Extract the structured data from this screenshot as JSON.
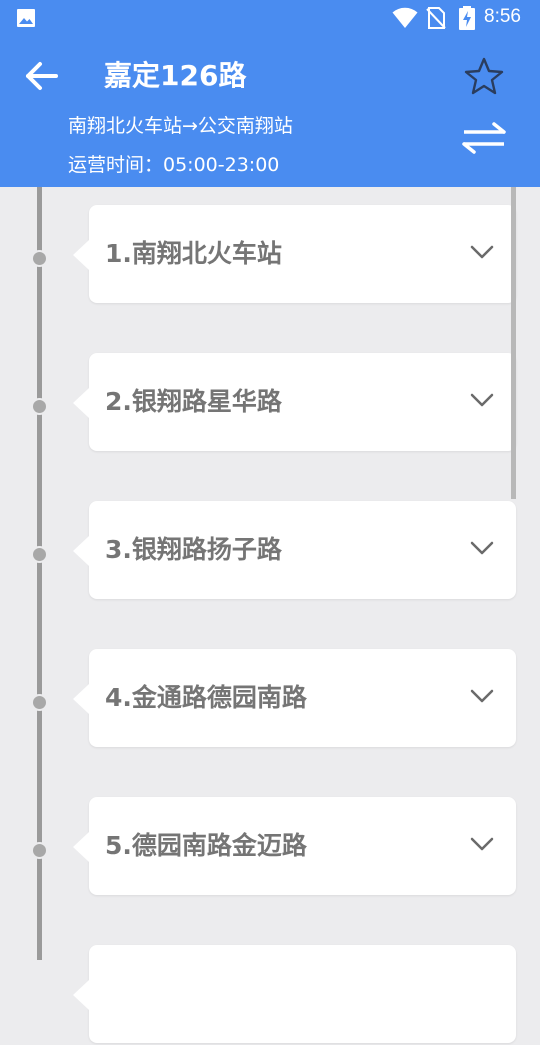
{
  "status_bar": {
    "time": "8:56",
    "icons": [
      "image-icon",
      "wifi-icon",
      "no-sim-icon",
      "battery-charging-icon"
    ]
  },
  "header": {
    "title": "嘉定126路",
    "route": "南翔北火车站→公交南翔站",
    "hours": "运营时间：05:00-23:00",
    "back_icon": "arrow-left-icon",
    "favorite_icon": "star-outline-icon",
    "swap_icon": "swap-direction-icon"
  },
  "colors": {
    "primary": "#4a8cf0",
    "background": "#ececee",
    "card": "#ffffff",
    "stop_text": "#757575",
    "timeline": "#9a9a9a"
  },
  "stops": [
    {
      "label": "1.南翔北火车站"
    },
    {
      "label": "2.银翔路星华路"
    },
    {
      "label": "3.银翔路扬子路"
    },
    {
      "label": "4.金通路德园南路"
    },
    {
      "label": "5.德园南路金迈路"
    }
  ]
}
